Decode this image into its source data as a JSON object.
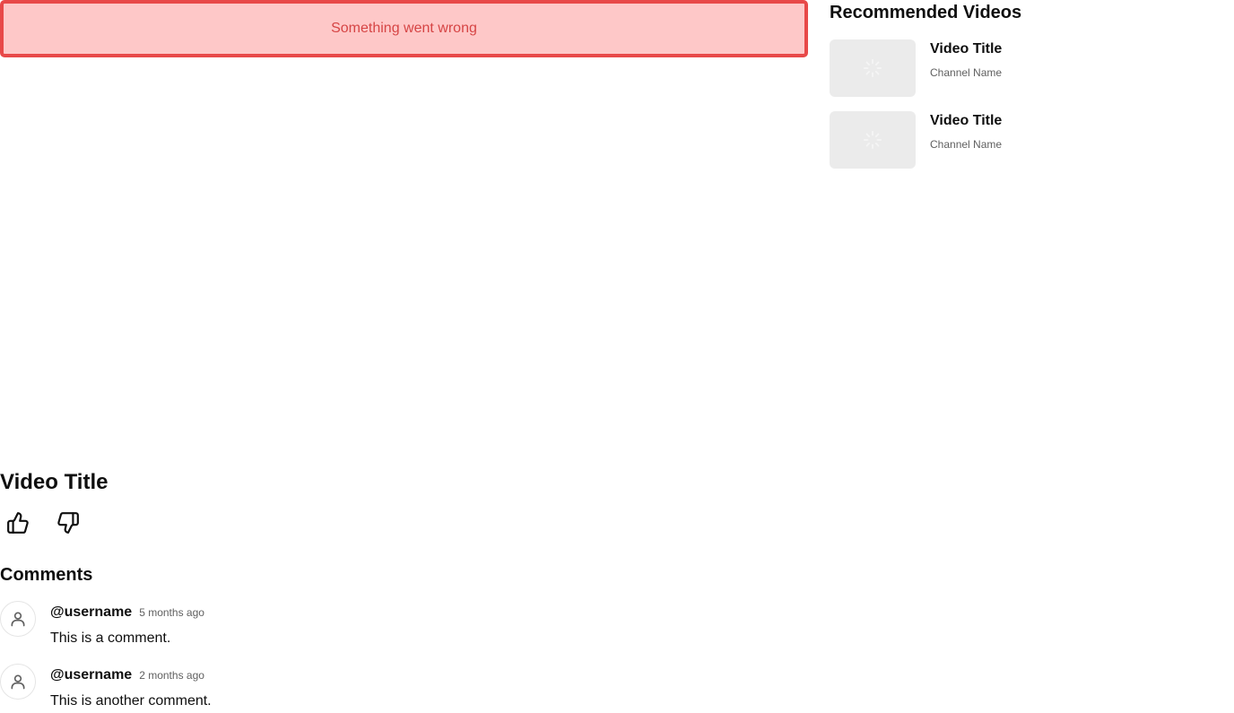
{
  "error": {
    "message": "Something went wrong"
  },
  "video": {
    "title": "Video Title"
  },
  "actions": {
    "like_icon": "thumbs-up-icon",
    "dislike_icon": "thumbs-down-icon"
  },
  "comments": {
    "heading": "Comments",
    "items": [
      {
        "username": "@username",
        "time": "5 months ago",
        "text": "This is a comment.",
        "avatar_icon": "user-icon"
      },
      {
        "username": "@username",
        "time": "2 months ago",
        "text": "This is another comment.",
        "avatar_icon": "user-icon"
      }
    ]
  },
  "sidebar": {
    "title": "Recommended Videos",
    "items": [
      {
        "title": "Video Title",
        "channel": "Channel Name",
        "thumbnail_icon": "loading-spinner-icon"
      },
      {
        "title": "Video Title",
        "channel": "Channel Name",
        "thumbnail_icon": "loading-spinner-icon"
      }
    ]
  },
  "colors": {
    "error_bg": "#fec8c8",
    "error_border": "#e84949",
    "error_text": "#d64545",
    "thumbnail_bg": "#ebebeb",
    "muted_text": "#606060"
  }
}
